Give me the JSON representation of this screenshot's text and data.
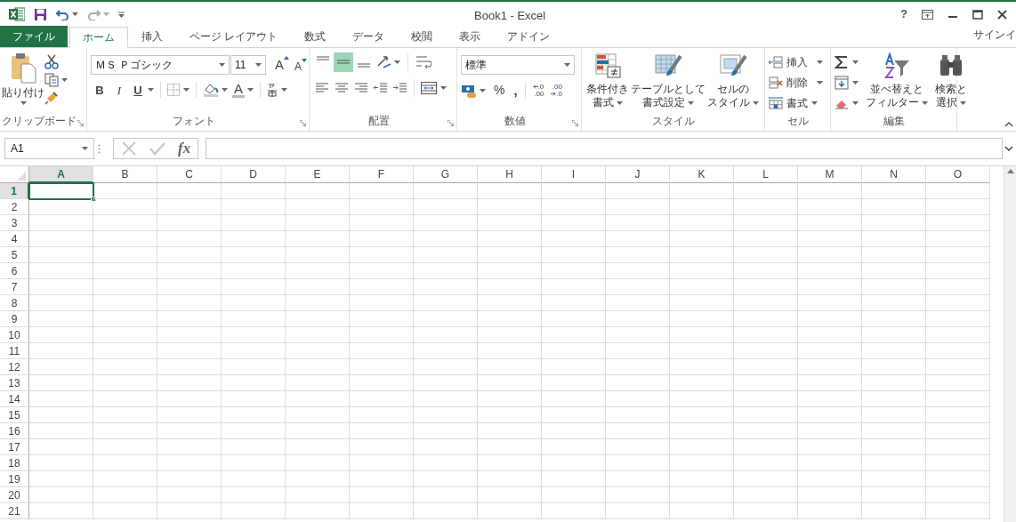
{
  "window": {
    "title": "Book1 - Excel",
    "help": "?"
  },
  "tabs": [
    {
      "kind": "file",
      "label": "ファイル",
      "selected": false
    },
    {
      "kind": "tab",
      "label": "ホーム",
      "selected": true
    },
    {
      "kind": "tab",
      "label": "挿入",
      "selected": false
    },
    {
      "kind": "tab",
      "label": "ページ レイアウト",
      "selected": false
    },
    {
      "kind": "tab",
      "label": "数式",
      "selected": false
    },
    {
      "kind": "tab",
      "label": "データ",
      "selected": false
    },
    {
      "kind": "tab",
      "label": "校閲",
      "selected": false
    },
    {
      "kind": "tab",
      "label": "表示",
      "selected": false
    },
    {
      "kind": "tab",
      "label": "アドイン",
      "selected": false
    }
  ],
  "sign_in": "サインイ",
  "ribbon": {
    "groups": [
      {
        "kind": "clipboard",
        "label": "クリップボード",
        "paste": "貼り付け"
      },
      {
        "kind": "font",
        "label": "フォント",
        "font_name": "ＭＳ Ｐゴシック",
        "font_size": "11",
        "grow": "A",
        "shrink": "A",
        "bold": "B",
        "italic": "I",
        "underline": "U",
        "font_color": "A"
      },
      {
        "kind": "alignment",
        "label": "配置",
        "vertical_align": [
          {
            "selected": false
          },
          {
            "selected": true
          },
          {
            "selected": false
          }
        ]
      },
      {
        "kind": "number",
        "label": "数値",
        "format": "標準",
        "percent": "%",
        "comma": ",",
        "inc_decimal": [
          ".0",
          ".00"
        ],
        "dec_decimal": [
          ".00",
          ".0"
        ]
      },
      {
        "kind": "styles",
        "label": "スタイル",
        "buttons": [
          {
            "kind": "conditional",
            "lines": [
              "条件付き",
              "書式"
            ]
          },
          {
            "kind": "table",
            "lines": [
              "テーブルとして",
              "書式設定"
            ]
          },
          {
            "kind": "cellstyle",
            "lines": [
              "セルの",
              "スタイル"
            ]
          }
        ]
      },
      {
        "kind": "cells",
        "label": "セル",
        "items": [
          {
            "kind": "insert",
            "label": "挿入"
          },
          {
            "kind": "delete",
            "label": "削除"
          },
          {
            "kind": "format",
            "label": "書式"
          }
        ]
      },
      {
        "kind": "editing",
        "label": "編集",
        "buttons": [
          {
            "kind": "sort",
            "lines": [
              "並べ替えと",
              "フィルター"
            ]
          },
          {
            "kind": "find",
            "lines": [
              "検索と",
              "選択"
            ]
          }
        ]
      }
    ]
  },
  "formula_bar": {
    "name_box": "A1",
    "fx": "fx"
  },
  "sheet": {
    "columns": [
      {
        "label": "A",
        "selected": true
      },
      {
        "label": "B",
        "selected": false
      },
      {
        "label": "C",
        "selected": false
      },
      {
        "label": "D",
        "selected": false
      },
      {
        "label": "E",
        "selected": false
      },
      {
        "label": "F",
        "selected": false
      },
      {
        "label": "G",
        "selected": false
      },
      {
        "label": "H",
        "selected": false
      },
      {
        "label": "I",
        "selected": false
      },
      {
        "label": "J",
        "selected": false
      },
      {
        "label": "K",
        "selected": false
      },
      {
        "label": "L",
        "selected": false
      },
      {
        "label": "M",
        "selected": false
      },
      {
        "label": "N",
        "selected": false
      },
      {
        "label": "O",
        "selected": false
      }
    ],
    "rows": [
      {
        "label": "1",
        "selected": true
      },
      {
        "label": "2",
        "selected": false
      },
      {
        "label": "3",
        "selected": false
      },
      {
        "label": "4",
        "selected": false
      },
      {
        "label": "5",
        "selected": false
      },
      {
        "label": "6",
        "selected": false
      },
      {
        "label": "7",
        "selected": false
      },
      {
        "label": "8",
        "selected": false
      },
      {
        "label": "9",
        "selected": false
      },
      {
        "label": "10",
        "selected": false
      },
      {
        "label": "11",
        "selected": false
      },
      {
        "label": "12",
        "selected": false
      },
      {
        "label": "13",
        "selected": false
      },
      {
        "label": "14",
        "selected": false
      },
      {
        "label": "15",
        "selected": false
      },
      {
        "label": "16",
        "selected": false
      },
      {
        "label": "17",
        "selected": false
      },
      {
        "label": "18",
        "selected": false
      },
      {
        "label": "19",
        "selected": false
      },
      {
        "label": "20",
        "selected": false
      },
      {
        "label": "21",
        "selected": false
      }
    ]
  }
}
